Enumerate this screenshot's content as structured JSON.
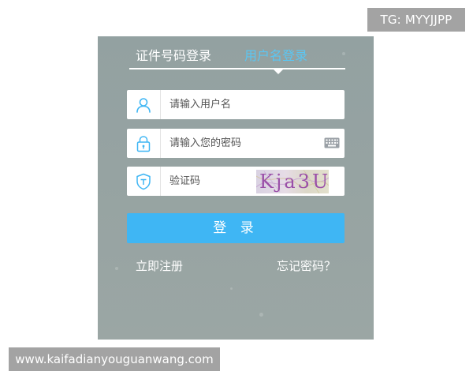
{
  "watermarks": {
    "top": "TG: MYYJJPP",
    "bottom": "www.kaifadianyouguanwang.com"
  },
  "login": {
    "tabs": [
      {
        "label": "证件号码登录",
        "active": false
      },
      {
        "label": "用户名登录",
        "active": true
      }
    ],
    "username": {
      "placeholder": "请输入用户名",
      "icon": "user-icon"
    },
    "password": {
      "placeholder": "请输入您的密码",
      "icon": "lock-icon",
      "trailing_icon": "keyboard-icon"
    },
    "captcha": {
      "placeholder": "验证码",
      "icon": "shield-icon",
      "image_text": "Kja3U"
    },
    "submit_label": "登 录",
    "register_label": "立即注册",
    "forgot_label": "忘记密码？"
  },
  "colors": {
    "accent": "#3fb6f4",
    "active_tab": "#5bc6f2",
    "panel_background": "#96a3a2",
    "watermark_background": "#a3a3a3"
  }
}
